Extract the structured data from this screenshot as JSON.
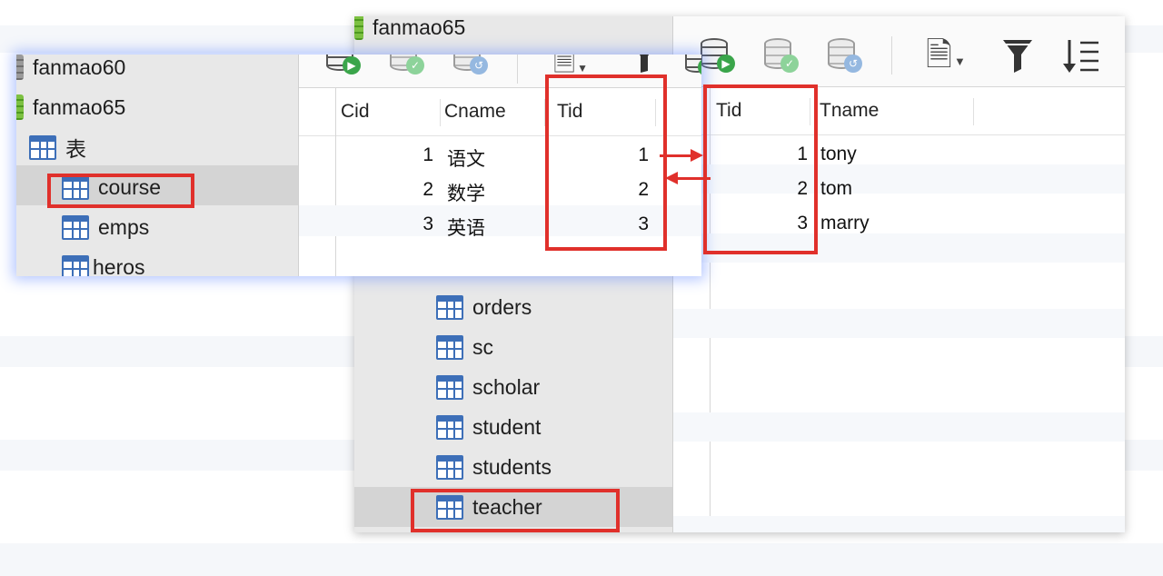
{
  "back": {
    "db_name": "fanmao65",
    "tables": [
      "orders",
      "sc",
      "scholar",
      "student",
      "students",
      "teacher"
    ],
    "grid": {
      "columns": [
        "Tid",
        "Tname"
      ],
      "rows": [
        {
          "tid": "1",
          "tname": "tony"
        },
        {
          "tid": "2",
          "tname": "tom"
        },
        {
          "tid": "3",
          "tname": "marry"
        }
      ]
    }
  },
  "front": {
    "databases": [
      "fanmao60",
      "fanmao65"
    ],
    "tables_group": "表",
    "tables": [
      "course",
      "emps",
      "heros"
    ],
    "grid": {
      "columns": [
        "Cid",
        "Cname",
        "Tid"
      ],
      "rows": [
        {
          "cid": "1",
          "cname": "语文",
          "tid": "1"
        },
        {
          "cid": "2",
          "cname": "数学",
          "tid": "2"
        },
        {
          "cid": "3",
          "cname": "英语",
          "tid": "3"
        }
      ]
    }
  },
  "colors": {
    "highlight": "#e0302b",
    "table_icon": "#3d6fb8",
    "db_icon": "#7dc142",
    "selected_row": "#d4d4d4"
  }
}
